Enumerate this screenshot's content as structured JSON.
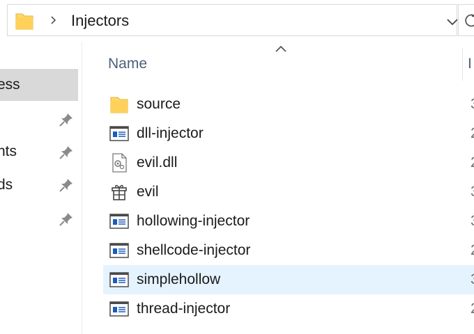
{
  "address_bar": {
    "path_label": "Injectors",
    "separator_icon": "chevron-right-icon",
    "dropdown_icon": "chevron-down-icon",
    "refresh_icon": "refresh-icon"
  },
  "nav": {
    "items": [
      {
        "label": "ess",
        "selected": true,
        "pinned": false
      },
      {
        "label": "",
        "selected": false,
        "pinned": true
      },
      {
        "label": "nts",
        "selected": false,
        "pinned": true
      },
      {
        "label": "ds",
        "selected": false,
        "pinned": true
      },
      {
        "label": "",
        "selected": false,
        "pinned": true
      }
    ]
  },
  "columns": {
    "name_header": "Name",
    "next_header": "I"
  },
  "files": [
    {
      "name": "source",
      "icon": "folder-icon",
      "extra": "3"
    },
    {
      "name": "dll-injector",
      "icon": "application-icon",
      "extra": "2"
    },
    {
      "name": "evil.dll",
      "icon": "dll-file-icon",
      "extra": "2"
    },
    {
      "name": "evil",
      "icon": "gift-icon",
      "extra": "3"
    },
    {
      "name": "hollowing-injector",
      "icon": "application-icon",
      "extra": "3"
    },
    {
      "name": "shellcode-injector",
      "icon": "application-icon",
      "extra": "2"
    },
    {
      "name": "simplehollow",
      "icon": "application-icon",
      "extra": "3",
      "hovered": true
    },
    {
      "name": "thread-injector",
      "icon": "application-icon",
      "extra": "2"
    }
  ],
  "colors": {
    "folder_yellow": "#ffd764",
    "selection_gray": "#d9d9d9",
    "hover_blue": "#e5f3ff",
    "app_icon_blue": "#1a5bbd",
    "header_text": "#4c607a"
  }
}
